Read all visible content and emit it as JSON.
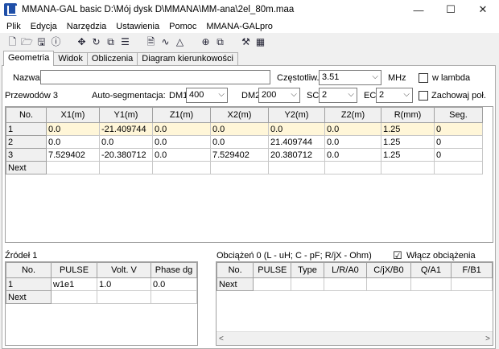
{
  "window": {
    "title": "MMANA-GAL basic D:\\Mój dysk D\\MMANA\\MM-ana\\2el_80m.maa",
    "minimize": "—",
    "maximize": "☐",
    "close": "✕"
  },
  "menu": [
    "Plik",
    "Edycja",
    "Narzędzia",
    "Ustawienia",
    "Pomoc",
    "MMANA-GALpro"
  ],
  "toolbar_icons": [
    [
      "new-file-icon",
      "open-folder-icon",
      "save-icon",
      "info-icon"
    ],
    [
      "move-icon",
      "rotate-icon",
      "edit-icon",
      "list-icon"
    ],
    [
      "view-icon",
      "wave-icon",
      "triangle-icon"
    ],
    [
      "crosshair-icon",
      "copy-icon"
    ],
    [
      "tools-icon",
      "calculator-icon"
    ]
  ],
  "toolbar_glyphs": [
    [
      "🗋",
      "🗁",
      "🖫",
      "ⓘ"
    ],
    [
      "✥",
      "↻",
      "⧉",
      "☰"
    ],
    [
      "🗎",
      "∿",
      "△"
    ],
    [
      "⊕",
      "⧉"
    ],
    [
      "⚒",
      "▦"
    ]
  ],
  "tabs": [
    "Geometria",
    "Widok",
    "Obliczenia",
    "Diagram kierunkowości"
  ],
  "geometry": {
    "name_label": "Nazwa",
    "name_value": "",
    "freq_label": "Częstotliw.",
    "freq_value": "3.51",
    "freq_unit": "MHz",
    "lambda_label": "w lambda",
    "wires_label": "Przewodów 3",
    "autoseg_label": "Auto-segmentacja:",
    "dm1_label": "DM1",
    "dm1_value": "400",
    "dm2_label": "DM2",
    "dm2_value": "200",
    "sc_label": "SC",
    "sc_value": "2",
    "ec_label": "EC",
    "ec_value": "2",
    "keep_label": "Zachowaj poł."
  },
  "wires_table": {
    "headers": [
      "No.",
      "X1(m)",
      "Y1(m)",
      "Z1(m)",
      "X2(m)",
      "Y2(m)",
      "Z2(m)",
      "R(mm)",
      "Seg."
    ],
    "rows": [
      [
        "1",
        "0.0",
        "-21.409744",
        "0.0",
        "0.0",
        "0.0",
        "0.0",
        "1.25",
        "0"
      ],
      [
        "2",
        "0.0",
        "0.0",
        "0.0",
        "0.0",
        "21.409744",
        "0.0",
        "1.25",
        "0"
      ],
      [
        "3",
        "7.529402",
        "-20.380712",
        "0.0",
        "7.529402",
        "20.380712",
        "0.0",
        "1.25",
        "0"
      ]
    ],
    "next_label": "Next"
  },
  "sources": {
    "title": "Źródeł 1",
    "headers": [
      "No.",
      "PULSE",
      "Volt. V",
      "Phase dg"
    ],
    "rows": [
      [
        "1",
        "w1e1",
        "1.0",
        "0.0"
      ]
    ],
    "next_label": "Next"
  },
  "loads": {
    "title": "Obciążeń 0 (L - uH; C - pF; R/jX - Ohm)",
    "enable_label": "Włącz obciążenia",
    "enable_checked": "☑",
    "headers": [
      "No.",
      "PULSE",
      "Type",
      "L/R/A0",
      "C/jX/B0",
      "Q/A1",
      "F/B1"
    ],
    "next_label": "Next",
    "scroll_left": "<",
    "scroll_right": ">"
  }
}
